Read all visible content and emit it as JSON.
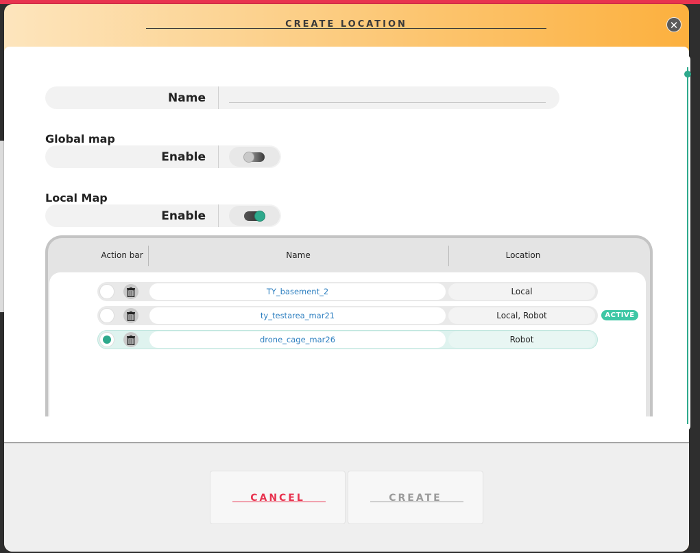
{
  "modal": {
    "title": "CREATE LOCATION",
    "close_icon": "close-icon"
  },
  "form": {
    "name_label": "Name",
    "name_value": "",
    "global_map": {
      "title": "Global map",
      "enable_label": "Enable",
      "enabled": false
    },
    "local_map": {
      "title": "Local Map",
      "enable_label": "Enable",
      "enabled": true
    }
  },
  "table": {
    "headers": [
      "Action bar",
      "Name",
      "Location"
    ],
    "rows": [
      {
        "name": "TY_basement_2",
        "location": "Local",
        "selected": false,
        "badge": ""
      },
      {
        "name": "ty_testarea_mar21",
        "location": "Local, Robot",
        "selected": false,
        "badge": "ACTIVE"
      },
      {
        "name": "drone_cage_mar26",
        "location": "Robot",
        "selected": true,
        "badge": ""
      }
    ]
  },
  "footer": {
    "cancel_label": "CANCEL",
    "create_label": "CREATE"
  },
  "colors": {
    "accent": "#2ea98c",
    "cancel": "#e8334f",
    "link": "#2d7fc0",
    "gradient_start": "#fde5bd",
    "gradient_end": "#fcb03e"
  }
}
